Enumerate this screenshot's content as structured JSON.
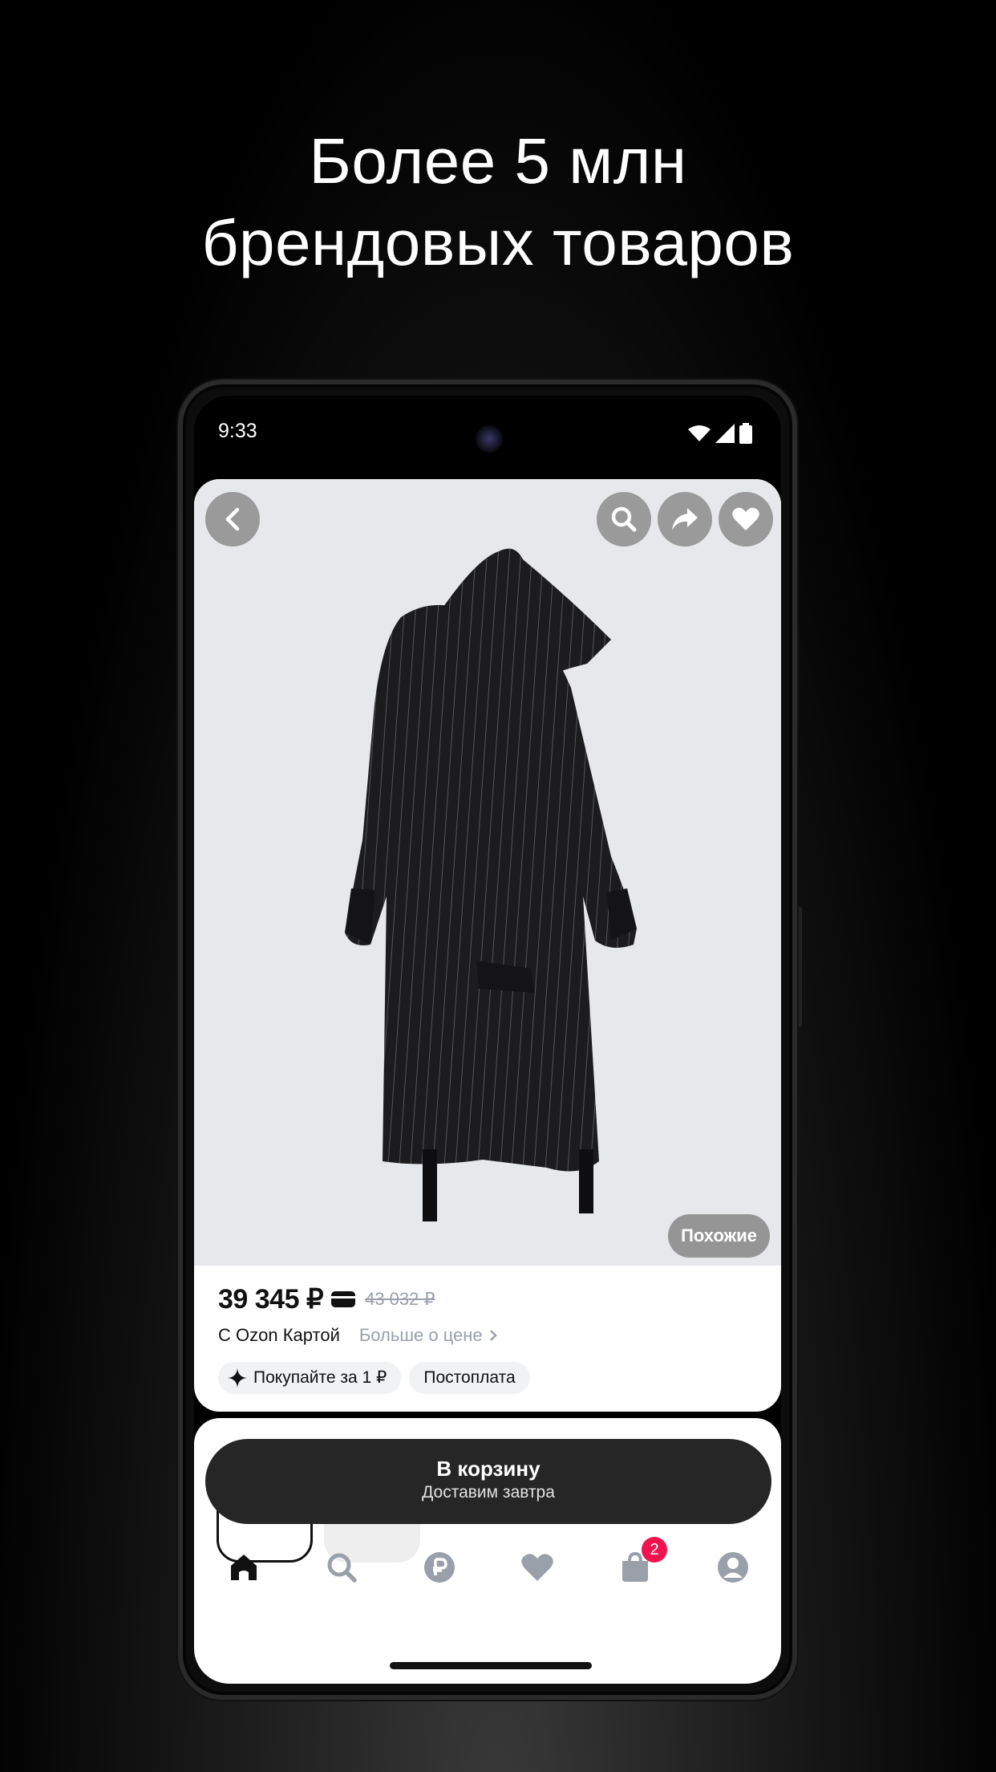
{
  "promo": {
    "headline_line1": "Более 5 млн",
    "headline_line2": "брендовых товаров"
  },
  "status_bar": {
    "time": "9:33"
  },
  "product": {
    "similar_label": "Похожие",
    "price": "39 345 ₽",
    "old_price": "43 032 ₽",
    "card_label": "С Ozon Картой",
    "more_about_price": "Больше о цене",
    "chips": [
      "Покупайте за 1 ₽",
      "Постоплата"
    ]
  },
  "cart_button": {
    "title": "В корзину",
    "subtitle": "Доставим завтра"
  },
  "bottom_nav": {
    "items": [
      "home-icon",
      "search-icon",
      "ruble-icon",
      "heart-icon",
      "bag-icon",
      "profile-icon"
    ],
    "cart_badge": "2"
  },
  "colors": {
    "badge": "#f1134e",
    "cart_button": "#262626",
    "hero_background": "#e7e8ec"
  }
}
